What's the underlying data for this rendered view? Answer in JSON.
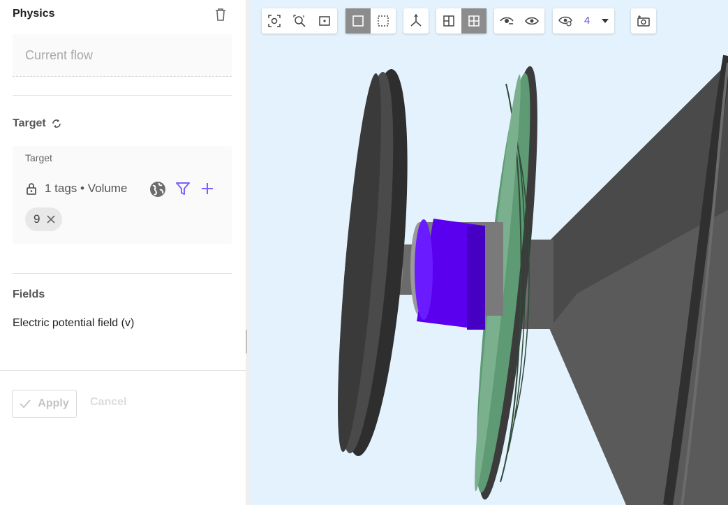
{
  "physics": {
    "title": "Physics",
    "flow_placeholder": "Current flow"
  },
  "target": {
    "title": "Target",
    "box_label": "Target",
    "tags_text": "1 tags • Volume",
    "chip_label": "9"
  },
  "fields": {
    "title": "Fields",
    "items": [
      "Electric potential field (v)"
    ]
  },
  "actions": {
    "apply_label": "Apply",
    "cancel_label": "Cancel"
  },
  "toolbar": {
    "visibility_count": "4",
    "icons": [
      "zoom-to-fit-icon",
      "zoom-region-icon",
      "center-icon",
      "solid-box-icon",
      "selection-box-icon",
      "axes-icon",
      "section-view-icon",
      "grid-view-icon",
      "hide-icon",
      "show-icon",
      "visibility-filter-icon",
      "chevron-down-icon",
      "screenshot-icon"
    ]
  },
  "colors": {
    "accent": "#7b61ff",
    "viewport_bg": "#e3f2fc",
    "magnet_purple": "#5a00ef",
    "coil_green": "#5e9a74"
  }
}
